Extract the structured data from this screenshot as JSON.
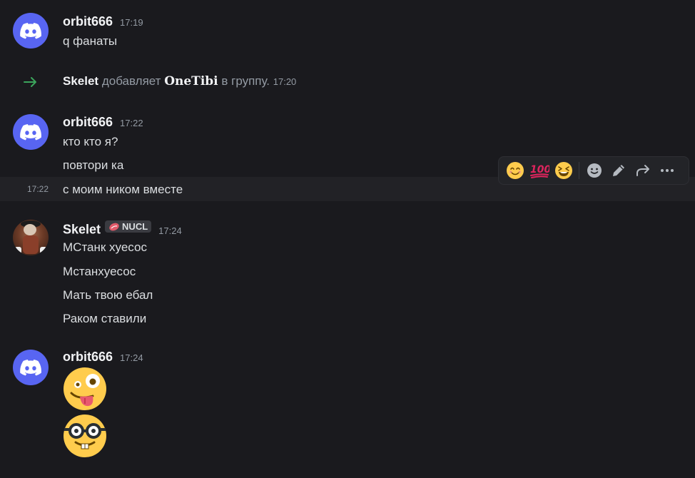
{
  "messages": {
    "m1": {
      "username": "orbit666",
      "time": "17:19",
      "lines": [
        "q фанаты"
      ]
    },
    "system": {
      "actor": "Skelet",
      "action": "добавляет",
      "target": "OneTibi",
      "suffix": "в группу.",
      "time": "17:20"
    },
    "m2": {
      "username": "orbit666",
      "time": "17:22",
      "lines": [
        "кто кто я?",
        "повтори ка",
        "с моим ником вместе"
      ],
      "hover_time": "17:22"
    },
    "m3": {
      "username": "Skelet",
      "tag": "NUCL",
      "time": "17:24",
      "lines": [
        "МСтанк хуесос",
        "Мстанхуесос",
        "Мать твою ебал",
        "Раком ставили"
      ]
    },
    "m4": {
      "username": "orbit666",
      "time": "17:24",
      "emojis": [
        "zany-face",
        "nerd-face"
      ]
    }
  },
  "toolbar": {
    "reactions": [
      "😊",
      "💯",
      "😆"
    ],
    "actions": [
      "add-reaction-icon",
      "edit-icon",
      "forward-icon",
      "more-icon"
    ]
  },
  "colors": {
    "discord_blurple": "#5865f2",
    "background": "#1a1a1e",
    "system_arrow": "#3ba55c"
  }
}
